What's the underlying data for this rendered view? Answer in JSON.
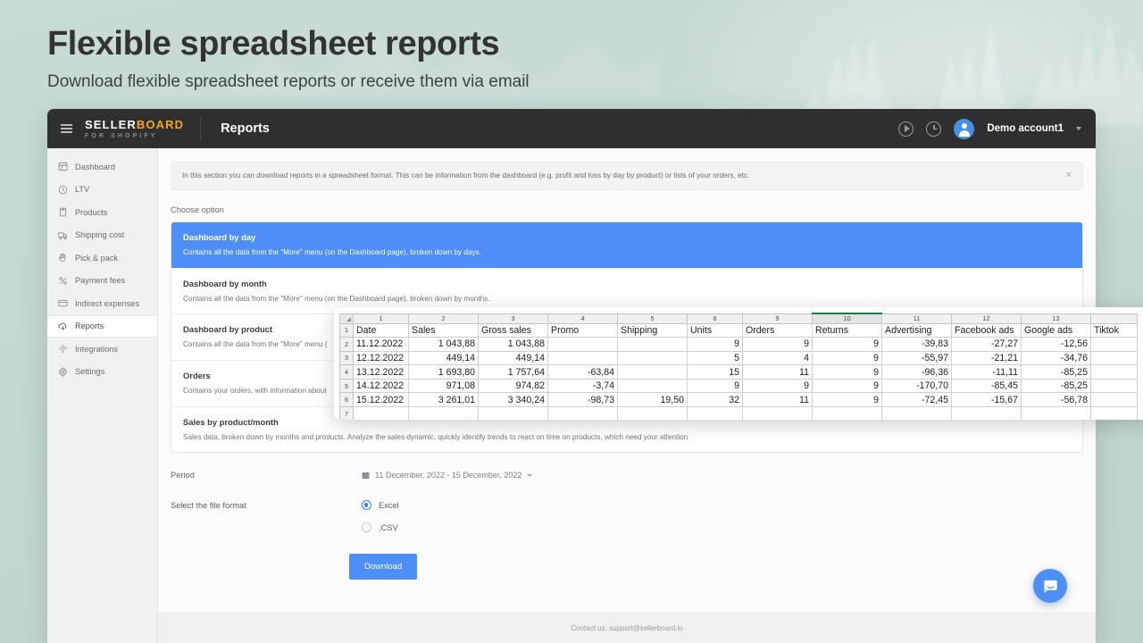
{
  "hero": {
    "title": "Flexible spreadsheet reports",
    "subtitle": "Download flexible spreadsheet reports or receive them via email"
  },
  "topbar": {
    "menu_icon": "hamburger-icon",
    "brand_main": "SELLER",
    "brand_accent": "BOARD",
    "brand_sub": "FOR SHOPIFY",
    "page_title": "Reports",
    "play_icon": "play-circle-icon",
    "clock_icon": "clock-icon",
    "account": "Demo account1",
    "caret_icon": "chevron-down-icon"
  },
  "sidebar": {
    "items": [
      {
        "label": "Dashboard",
        "icon": "dashboard-icon",
        "active": false
      },
      {
        "label": "LTV",
        "icon": "clock-icon",
        "active": false
      },
      {
        "label": "Products",
        "icon": "box-icon",
        "active": false
      },
      {
        "label": "Shipping cost",
        "icon": "truck-icon",
        "active": false
      },
      {
        "label": "Pick & pack",
        "icon": "hand-icon",
        "active": false
      },
      {
        "label": "Payment fees",
        "icon": "percent-icon",
        "active": false
      },
      {
        "label": "Indirect expenses",
        "icon": "card-icon",
        "active": false
      },
      {
        "label": "Reports",
        "icon": "cloud-download-icon",
        "active": true
      },
      {
        "label": "Integrations",
        "icon": "puzzle-icon",
        "active": false
      },
      {
        "label": "Settings",
        "icon": "gear-icon",
        "active": false
      }
    ]
  },
  "main": {
    "banner": {
      "text": "In this section you can download reports in a spreadsheet format. This can be information from the dashboard (e.g. profit and loss by day by product) or lists of your orders, etc.",
      "close_icon": "close-icon"
    },
    "choose_label": "Choose option",
    "options": [
      {
        "title": "Dashboard by day",
        "desc": "Contains all the data from the \"More\" menu (on the Dashboard page), broken down by days.",
        "selected": true
      },
      {
        "title": "Dashboard by month",
        "desc": "Contains all the data from the \"More\" menu (on the Dashboard page), broken down by months.",
        "selected": false
      },
      {
        "title": "Dashboard by product",
        "desc": "Contains all the data from the \"More\" menu (",
        "selected": false
      },
      {
        "title": "Orders",
        "desc": "Contains your orders, with information about",
        "selected": false
      },
      {
        "title": "Sales by product/month",
        "desc": "Sales data, broken down by months and products. Analyze the sales dynamic, quickly identify trends to react on time on products, which need your attention",
        "selected": false
      }
    ],
    "period": {
      "label": "Period",
      "calendar_icon": "calendar-icon",
      "value": "11 December, 2022 - 15 December, 2022",
      "chevron_icon": "chevron-down-icon"
    },
    "file_format": {
      "label": "Select the file format",
      "options": [
        {
          "label": "Excel",
          "checked": true
        },
        {
          "label": ".CSV",
          "checked": false
        }
      ]
    },
    "download_label": "Download",
    "footer": "Contact us: support@sellerboard.io",
    "chat_icon": "chat-bubble-icon"
  },
  "spreadsheet": {
    "col_numbers": [
      "1",
      "2",
      "3",
      "4",
      "5",
      "8",
      "9",
      "10",
      "11",
      "12",
      "13",
      ""
    ],
    "selected_col_index": 7,
    "headers": [
      "Date",
      "Sales",
      "Gross sales",
      "Promo",
      "Shipping",
      "Units",
      "Orders",
      "Returns",
      "Advertising",
      "Facebook ads",
      "Google ads",
      "Tiktok"
    ],
    "row_numbers": [
      "1",
      "2",
      "3",
      "4",
      "5",
      "6",
      "7"
    ],
    "rows": [
      [
        "11.12.2022",
        "1 043,88",
        "1 043,88",
        "",
        "",
        "9",
        "9",
        "9",
        "-39,83",
        "-27,27",
        "-12,56",
        ""
      ],
      [
        "12.12.2022",
        "449,14",
        "449,14",
        "",
        "",
        "5",
        "4",
        "9",
        "-55,97",
        "-21,21",
        "-34,76",
        ""
      ],
      [
        "13.12.2022",
        "1 693,80",
        "1 757,64",
        "-63,84",
        "",
        "15",
        "11",
        "9",
        "-96,36",
        "-11,11",
        "-85,25",
        ""
      ],
      [
        "14.12.2022",
        "971,08",
        "974,82",
        "-3,74",
        "",
        "9",
        "9",
        "9",
        "-170,70",
        "-85,45",
        "-85,25",
        ""
      ],
      [
        "15.12.2022",
        "3 261,01",
        "3 340,24",
        "-98,73",
        "19,50",
        "32",
        "11",
        "9",
        "-72,45",
        "-15,67",
        "-56,78",
        ""
      ],
      [
        "",
        "",
        "",
        "",
        "",
        "",
        "",
        "",
        "",
        "",
        "",
        ""
      ]
    ]
  },
  "colors": {
    "accent_blue": "#4d8ef7",
    "brand_orange": "#f5a623",
    "topbar_dark": "#2f2f2f",
    "page_bg": "#c6d9d5",
    "sheet_selected_border": "#1a7a43"
  }
}
